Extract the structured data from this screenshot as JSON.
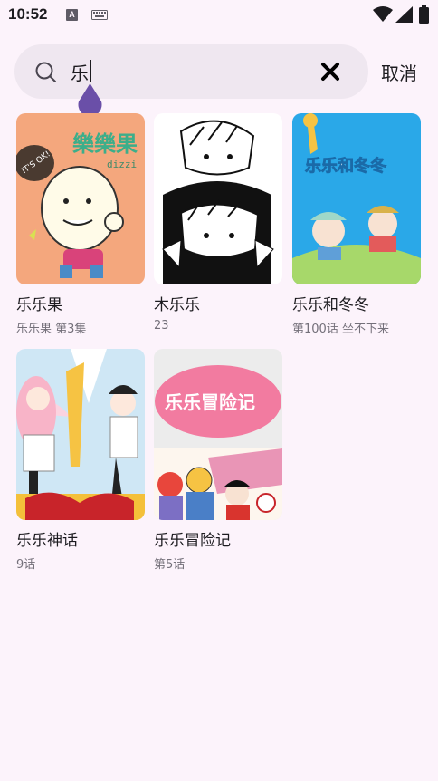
{
  "status_bar": {
    "time": "10:52",
    "notification_icon_letter": "A",
    "icons": [
      "a-notification-icon",
      "keyboard-icon",
      "wifi-icon",
      "signal-icon",
      "battery-icon"
    ]
  },
  "search": {
    "query": "乐",
    "cancel_label": "取消"
  },
  "results": [
    {
      "title": "乐乐果",
      "subtitle": "乐乐果 第3集",
      "cover_text": "樂樂果",
      "cover_text2": "dizzi",
      "cover_badge": "IT'S OK!"
    },
    {
      "title": "木乐乐",
      "subtitle": "23"
    },
    {
      "title": "乐乐和冬冬",
      "subtitle": "第100话 坐不下来",
      "cover_text": "乐乐和冬冬"
    },
    {
      "title": "乐乐神话",
      "subtitle": "9话"
    },
    {
      "title": "乐乐冒险记",
      "subtitle": "第5话",
      "cover_text": "乐乐冒险记"
    }
  ],
  "colors": {
    "background": "#fcf3fb",
    "search_box": "#efe7f0",
    "caret_handle": "#6a4fa8",
    "subtitle": "#74707a"
  }
}
